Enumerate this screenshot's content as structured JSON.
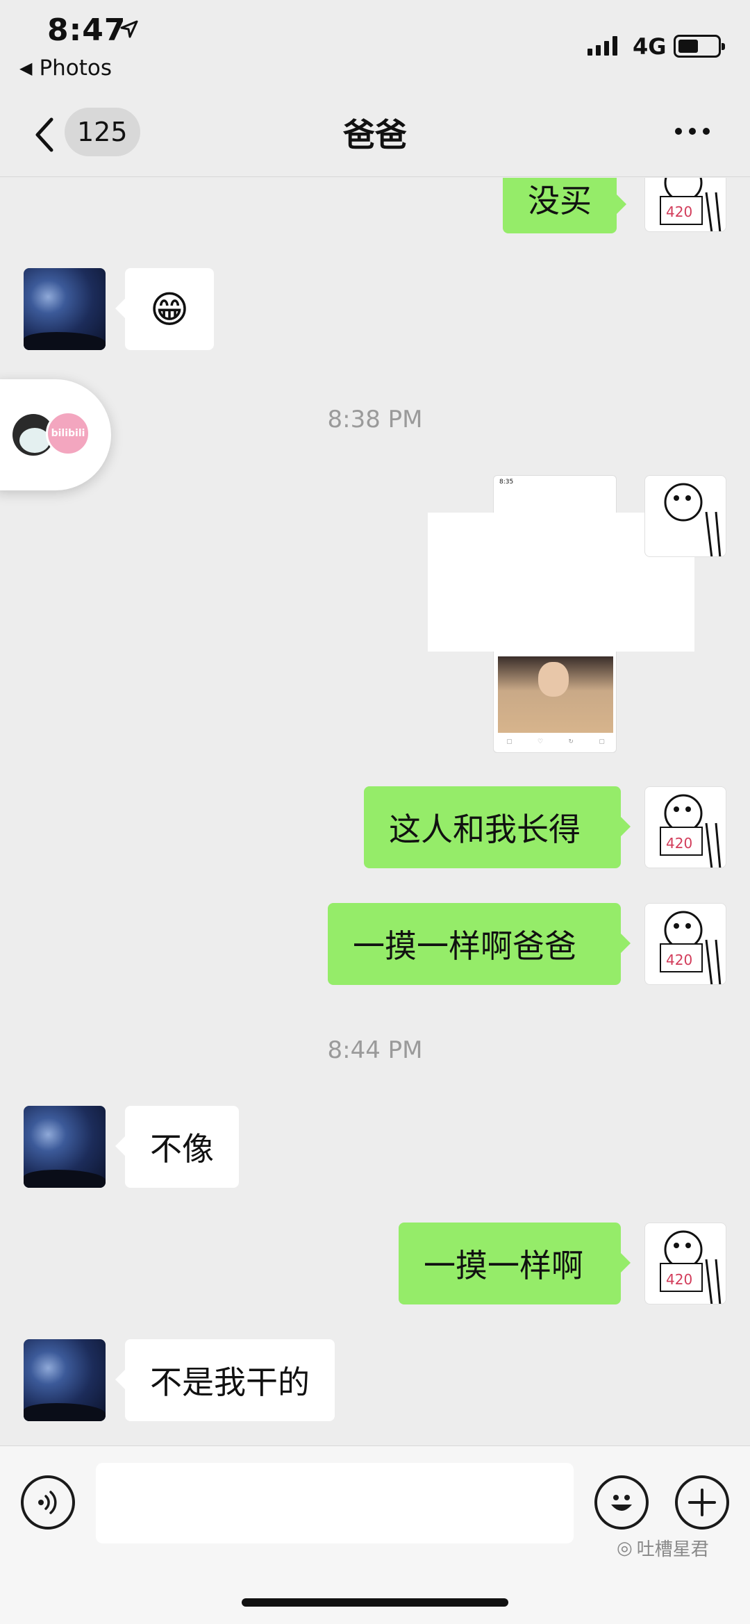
{
  "status_bar": {
    "time": "8:47",
    "back_app_label": "Photos",
    "network": "4G"
  },
  "nav": {
    "unread_count": "125",
    "title": "爸爸"
  },
  "messages": {
    "m1": "没买",
    "m2_emoji": "😁",
    "ts1": "8:38 PM",
    "m4": "这人和我长得",
    "m5": "一摸一样啊爸爸",
    "ts2": "8:44 PM",
    "m6": "不像",
    "m7": "一摸一样啊",
    "m8": "不是我干的"
  },
  "floating": {
    "brand": "bilibili"
  },
  "screenshot_thumb": {
    "time": "8:35"
  },
  "input": {
    "placeholder": ""
  },
  "watermark": "吐槽星君",
  "colors": {
    "background": "#ededed",
    "sent_bubble": "#95ec69",
    "received_bubble": "#ffffff",
    "timestamp": "#9a9a9a"
  },
  "icons": {
    "voice": "voice-icon",
    "emoji": "emoji-icon",
    "add": "plus-icon",
    "back": "chevron-left-icon",
    "more": "more-icon"
  }
}
